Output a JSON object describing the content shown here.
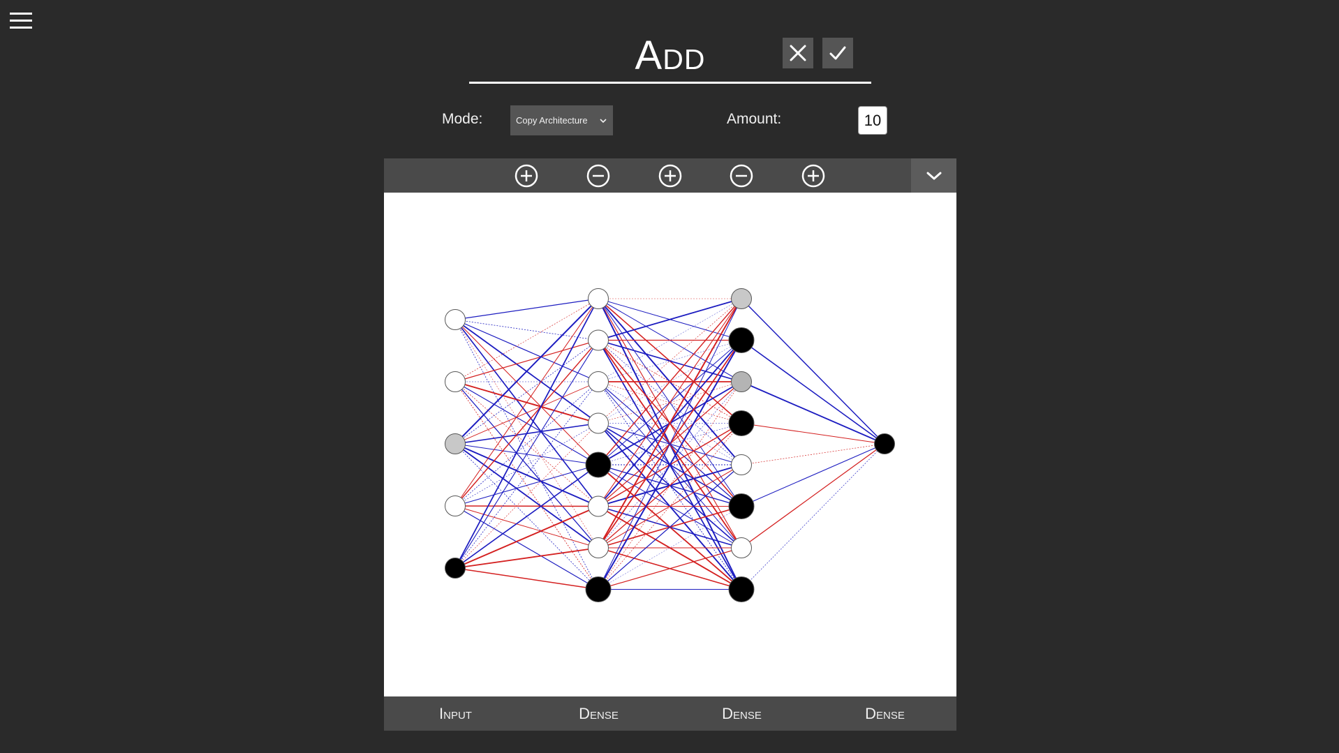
{
  "header": {
    "title": "Add",
    "cancel_icon": "close-icon",
    "confirm_icon": "check-icon"
  },
  "options": {
    "mode_label": "Mode:",
    "mode_value": "Copy Architecture",
    "amount_label": "Amount:",
    "amount_value": "10"
  },
  "toolbar": {
    "buttons": [
      "plus-circle-icon",
      "minus-circle-icon",
      "plus-circle-icon",
      "minus-circle-icon",
      "plus-circle-icon"
    ],
    "collapse_icon": "chevron-down-icon"
  },
  "layers": [
    {
      "label": "Input",
      "nodes": [
        "white",
        "white",
        "lightgray",
        "white",
        "black"
      ]
    },
    {
      "label": "Dense",
      "nodes": [
        "white",
        "white",
        "white",
        "white",
        "black",
        "white",
        "white",
        "black"
      ]
    },
    {
      "label": "Dense",
      "nodes": [
        "lightgray",
        "black",
        "gray",
        "black",
        "white",
        "black",
        "white",
        "black"
      ]
    },
    {
      "label": "Dense",
      "nodes": [
        "black"
      ]
    }
  ],
  "colors": {
    "positive_weight": "#d42020",
    "negative_weight": "#1c1cc0",
    "background": "#2a2a2a"
  }
}
